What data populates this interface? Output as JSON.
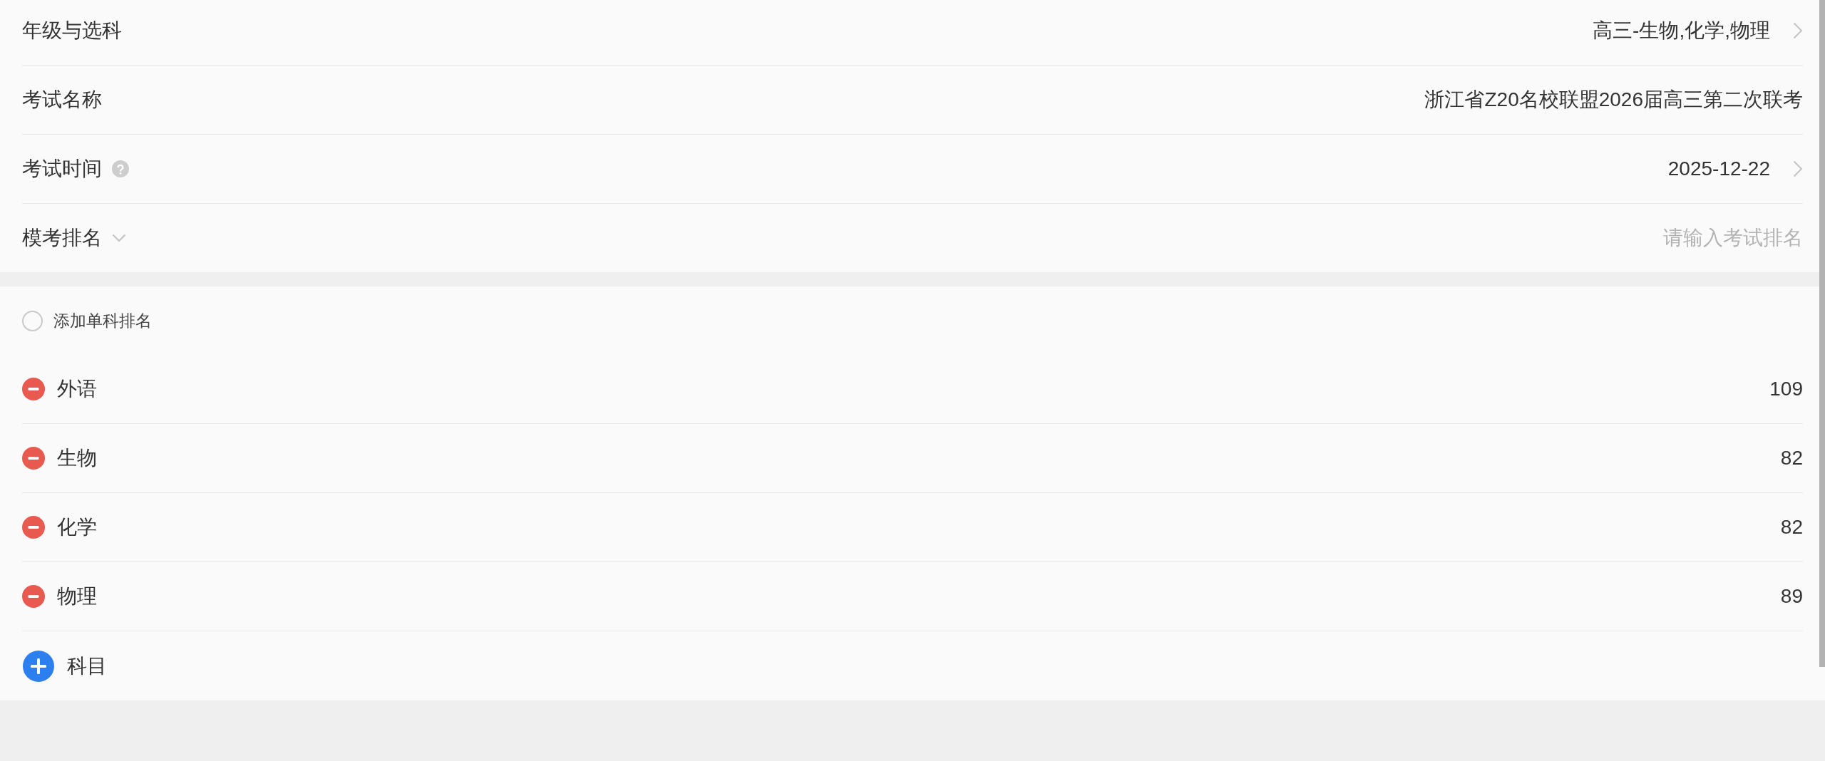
{
  "form": {
    "rows": [
      {
        "kind": "picker",
        "label": "年级与选科",
        "value": "高三-生物,化学,物理"
      },
      {
        "kind": "text",
        "label": "考试名称",
        "value": "浙江省Z20名校联盟2026届高三第二次联考"
      },
      {
        "kind": "picker",
        "label": "考试时间",
        "label_icon": {
          "kind": "help"
        },
        "value": "2025-12-22"
      },
      {
        "kind": "input",
        "label": "模考排名",
        "label_icon": {
          "kind": "caret"
        },
        "placeholder": "请输入考试排名"
      }
    ]
  },
  "single_subject_ranking": {
    "label": "添加单科排名",
    "checked": false
  },
  "subjects": [
    {
      "name": "外语",
      "rank": "109"
    },
    {
      "name": "生物",
      "rank": "82"
    },
    {
      "name": "化学",
      "rank": "82"
    },
    {
      "name": "物理",
      "rank": "89"
    }
  ],
  "add_subject_button": {
    "label": "科目"
  }
}
